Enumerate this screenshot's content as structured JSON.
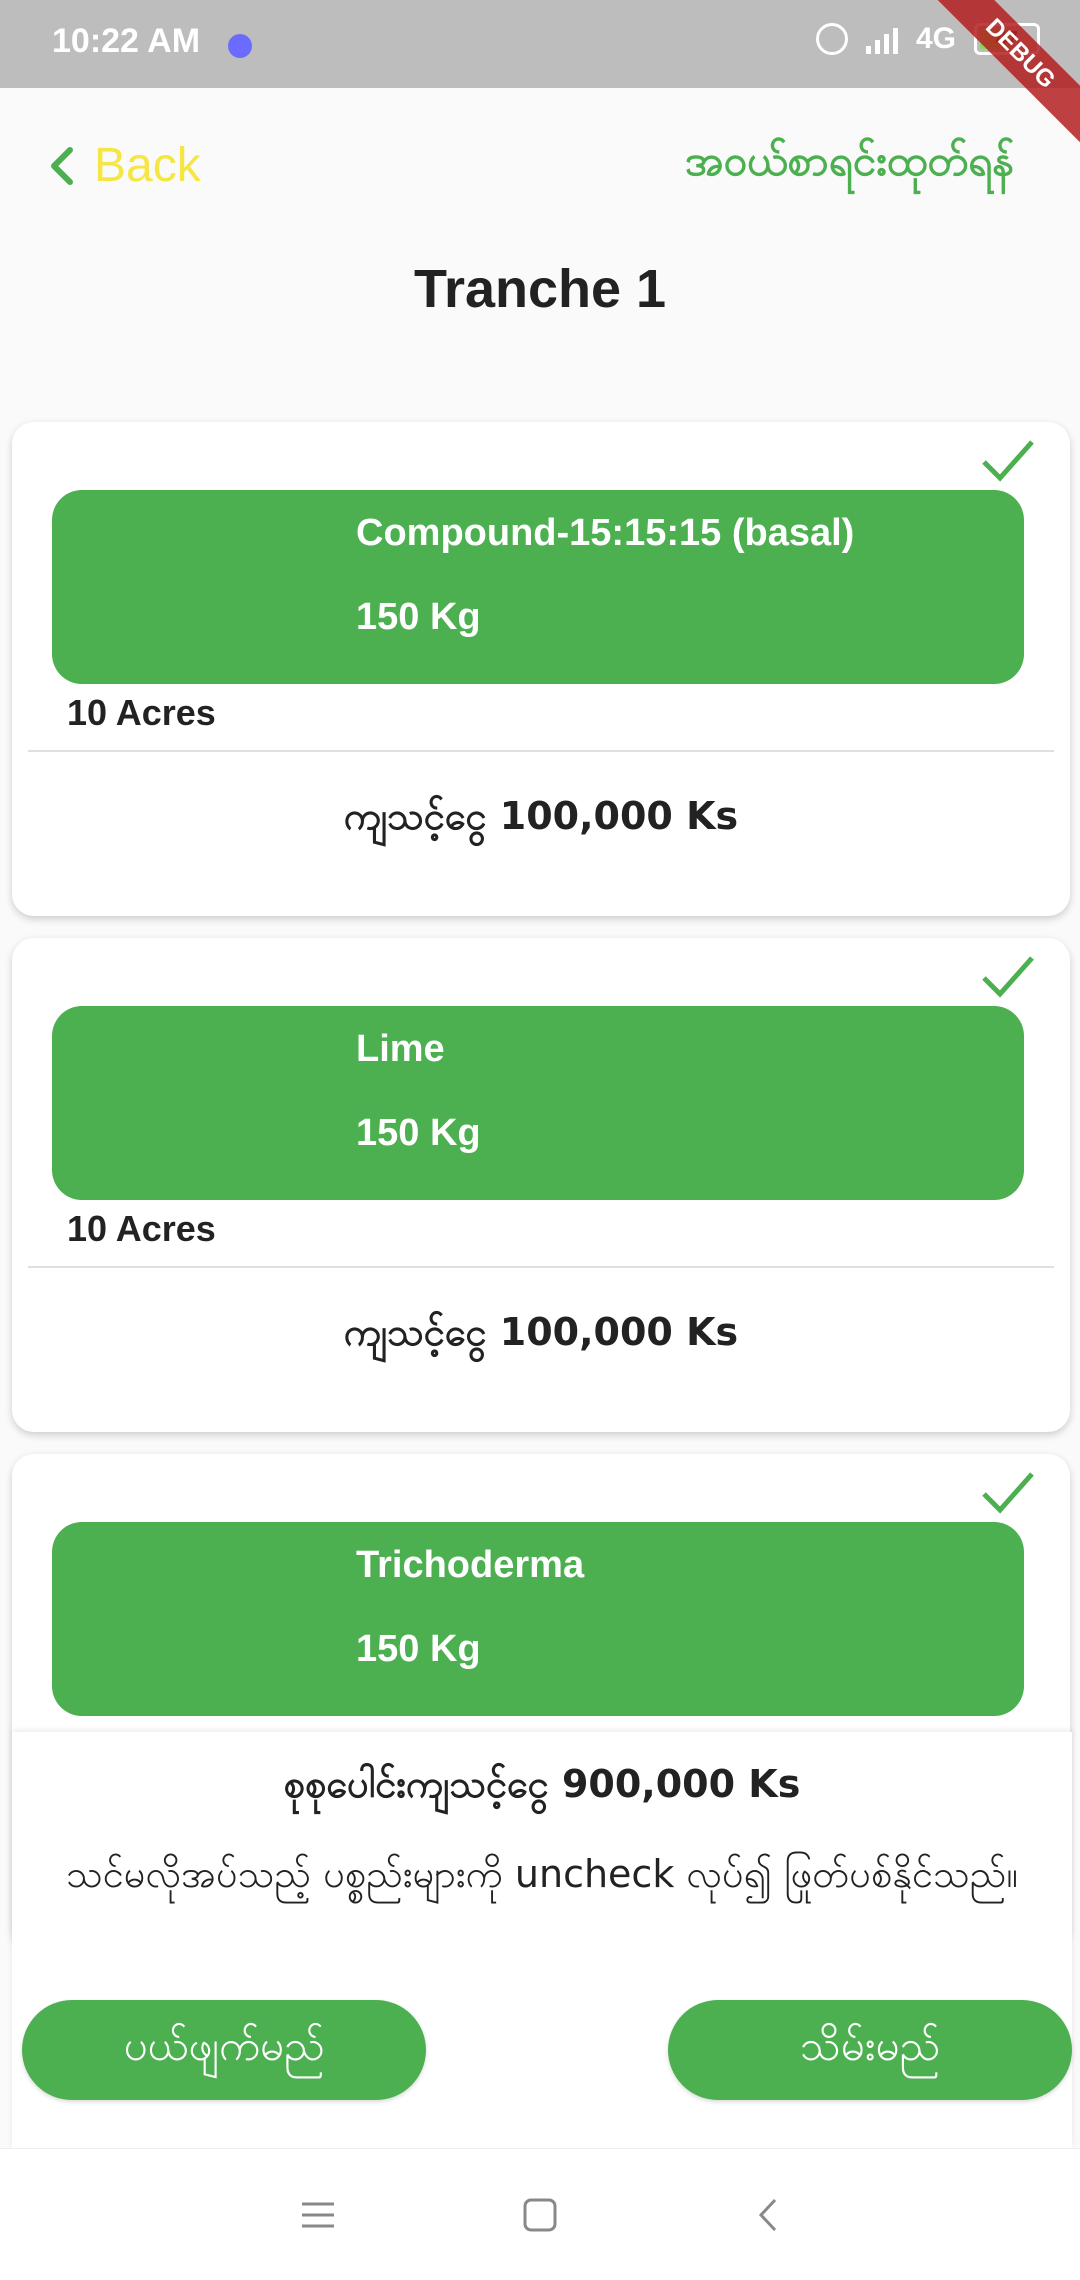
{
  "status_bar": {
    "time": "10:22 AM",
    "network": "4G",
    "battery": "47",
    "debug_banner": "DEBUG"
  },
  "header": {
    "back_label": "Back",
    "right_action": "အဝယ်စာရင်းထုတ်ရန်",
    "title": "Tranche 1"
  },
  "items": [
    {
      "name": "Compound-15:15:15 (basal)",
      "quantity": "150 Kg",
      "area": "10 Acres",
      "price": "ကျသင့်ငွေ 100,000 Ks",
      "checked": true
    },
    {
      "name": "Lime",
      "quantity": "150 Kg",
      "area": "10 Acres",
      "price": "ကျသင့်ငွေ 100,000 Ks",
      "checked": true
    },
    {
      "name": "Trichoderma",
      "quantity": "150 Kg",
      "checked": true
    }
  ],
  "summary": {
    "total": "စုစုပေါင်းကျသင့်ငွေ 900,000 Ks",
    "note": "သင်မလိုအပ်သည့် ပစ္စည်းများကို uncheck လုပ်၍ ဖြုတ်ပစ်နိုင်သည်။",
    "cancel_label": "ပယ်ဖျက်မည်",
    "save_label": "သိမ်းမည်"
  },
  "colors": {
    "accent": "#4caf50",
    "back": "#f5e643",
    "status_bar": "#bdbdbd"
  }
}
